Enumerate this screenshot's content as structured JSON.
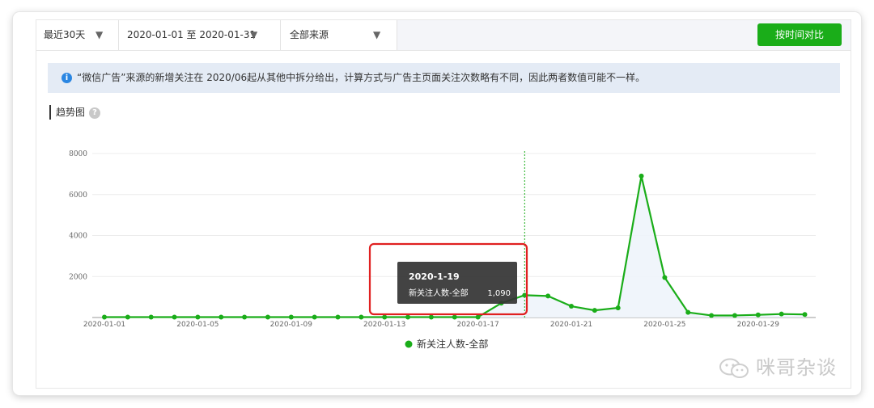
{
  "filters": {
    "period": "最近30天",
    "date_range": "2020-01-01 至 2020-01-31",
    "source": "全部来源"
  },
  "compare_button": "按时间对比",
  "notice": {
    "text": "“微信广告”来源的新增关注在 2020/06起从其他中拆分给出，计算方式与广告主页面关注次数略有不同，因此两者数值可能不一样。"
  },
  "section": {
    "title": "趋势图",
    "help": "?"
  },
  "tooltip": {
    "date": "2020-1-19",
    "series": "新关注人数-全部",
    "value": "1,090"
  },
  "watermark": "咪哥杂谈",
  "colors": {
    "series": "#1aad19",
    "accent": "#1aad19",
    "highlight": "#e02020",
    "info": "#2a86e2"
  },
  "chart_data": {
    "type": "line",
    "title": "趋势图",
    "xlabel": "",
    "ylabel": "",
    "ylim": [
      0,
      8000
    ],
    "y_ticks": [
      "8000",
      "6000",
      "4000",
      "2000"
    ],
    "x_ticks": [
      "2020-01-01",
      "2020-01-05",
      "2020-01-09",
      "2020-01-13",
      "2020-01-17",
      "2020-01-21",
      "2020-01-25",
      "2020-01-29"
    ],
    "x": [
      "2020-01-01",
      "2020-01-02",
      "2020-01-03",
      "2020-01-04",
      "2020-01-05",
      "2020-01-06",
      "2020-01-07",
      "2020-01-08",
      "2020-01-09",
      "2020-01-10",
      "2020-01-11",
      "2020-01-12",
      "2020-01-13",
      "2020-01-14",
      "2020-01-15",
      "2020-01-16",
      "2020-01-17",
      "2020-01-18",
      "2020-01-19",
      "2020-01-20",
      "2020-01-21",
      "2020-01-22",
      "2020-01-23",
      "2020-01-24",
      "2020-01-25",
      "2020-01-26",
      "2020-01-27",
      "2020-01-28",
      "2020-01-29",
      "2020-01-30",
      "2020-01-31"
    ],
    "series": [
      {
        "name": "新关注人数-全部",
        "values": [
          20,
          20,
          20,
          20,
          20,
          20,
          20,
          20,
          20,
          20,
          20,
          20,
          20,
          20,
          20,
          20,
          20,
          700,
          1090,
          1050,
          550,
          350,
          470,
          6900,
          1950,
          250,
          100,
          100,
          130,
          170,
          150,
          100
        ]
      }
    ],
    "highlight_index": 18,
    "grid": true,
    "legend": "bottom-center"
  }
}
